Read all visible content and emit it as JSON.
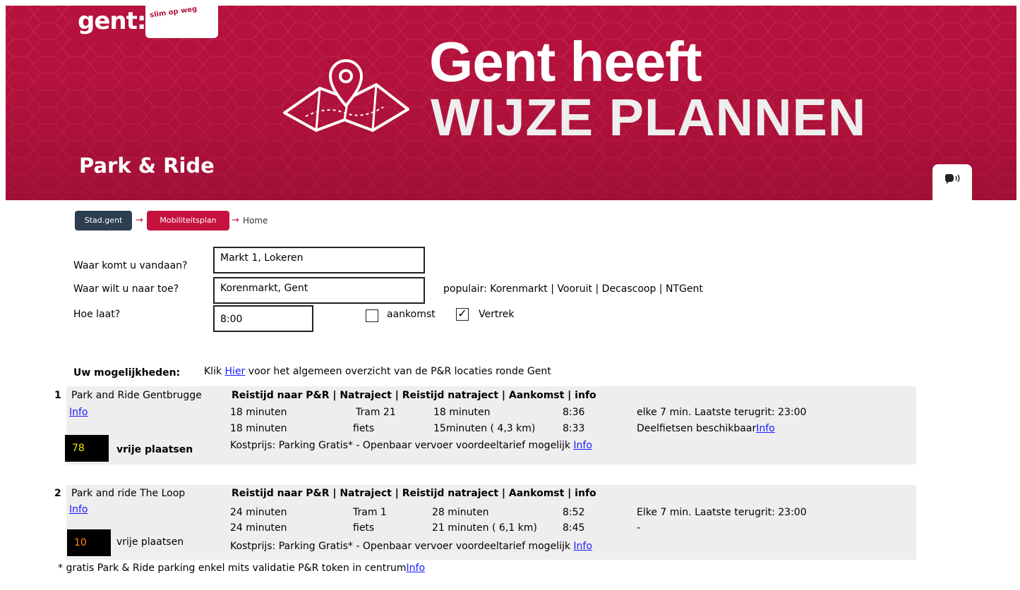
{
  "header": {
    "logo_main": "gent:",
    "logo_tagline": "slim op weg",
    "title_line1": "Gent heeft",
    "title_line2": "WIJZE PLANNEN",
    "subtitle": "Park & Ride",
    "speak_icon": "speaker-icon"
  },
  "breadcrumb": {
    "items": [
      "Stad.gent",
      "Mobiliteitsplan",
      "Home"
    ],
    "separator": "→"
  },
  "form": {
    "from_label": "Waar komt u vandaan?",
    "from_value": "Markt 1, Lokeren",
    "to_label": "Waar wilt u naar toe?",
    "to_value": "Korenmarkt, Gent",
    "popular": "populair: Korenmarkt | Vooruit | Decascoop | NTGent",
    "time_label": "Hoe laat?",
    "time_value": "8:00",
    "arrival_label": "aankomst",
    "arrival_checked": false,
    "departure_label": "Vertrek",
    "departure_checked": true
  },
  "results": {
    "heading": "Uw mogelijkheden:",
    "intro_before": "Klik",
    "intro_link": "Hier",
    "intro_after": "voor het algemeen overzicht van de P&R locaties ronde Gent",
    "columns": "Reistijd naar P&R | Natraject | Reistijd natraject | Aankomst | info",
    "spaces_label": "vrije plaatsen",
    "info_link": "Info",
    "options": [
      {
        "number": "1",
        "name": "Park and Ride Gentbrugge",
        "free_spaces": "78",
        "free_color": "#f2e600",
        "rows": [
          {
            "time": "18 minuten",
            "mode": "Tram 21",
            "duration": "18 minuten",
            "arrival": "8:36",
            "info": "elke 7 min. Laatste terugrit: 23:00"
          },
          {
            "time": "18 minuten",
            "mode": "fiets",
            "duration": "15minuten ( 4,3 km)",
            "arrival": "8:33",
            "info": "Deelfietsen beschikbaar"
          }
        ],
        "cost": "Kostprijs: Parking Gratis* - Openbaar vervoer voordeeltarief mogelijk"
      },
      {
        "number": "2",
        "name": "Park and ride The Loop",
        "free_spaces": "10",
        "free_color": "#ff8c00",
        "rows": [
          {
            "time": "24 minuten",
            "mode": "Tram 1",
            "duration": "28 minuten",
            "arrival": "8:52",
            "info": "Elke 7 min. Laatste terugrit: 23:00"
          },
          {
            "time": "24 minuten",
            "mode": "fiets",
            "duration": "21 minuten ( 6,1 km)",
            "arrival": "8:45",
            "info": "-"
          }
        ],
        "cost": "Kostprijs: Parking Gratis* - Openbaar vervoer voordeeltarief mogelijk"
      }
    ],
    "footnote": "* gratis Park & Ride parking enkel mits validatie P&R token in centrum"
  }
}
